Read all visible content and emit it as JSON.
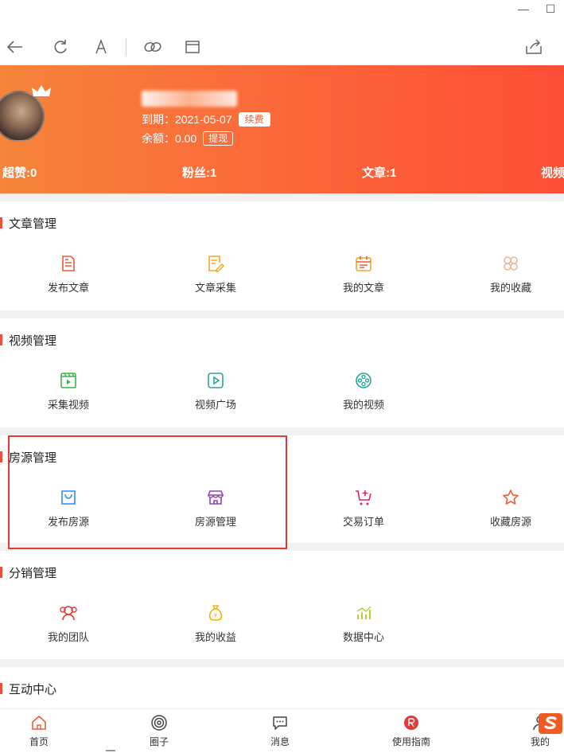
{
  "toolbar": {
    "icons": [
      "back-arrow-icon",
      "refresh-icon",
      "font-icon",
      "link-icon",
      "window-icon",
      "share-icon"
    ]
  },
  "profile": {
    "expiry_label": "到期：2021-05-07",
    "renew_label": "续费",
    "balance_label": "余额：0.00",
    "withdraw_label": "提现",
    "stats": [
      {
        "label": "超赞:0"
      },
      {
        "label": "粉丝:1"
      },
      {
        "label": "文章:1"
      },
      {
        "label": "视频"
      }
    ]
  },
  "sections": [
    {
      "title": "文章管理",
      "items": [
        {
          "label": "发布文章",
          "icon": "edit-document-icon",
          "color": "#f25a35"
        },
        {
          "label": "文章采集",
          "icon": "collect-edit-icon",
          "color": "#f5a623"
        },
        {
          "label": "我的文章",
          "icon": "calendar-icon",
          "color": "#f5a623"
        },
        {
          "label": "我的收藏",
          "icon": "clover-icon",
          "color": "#e6b89c"
        }
      ]
    },
    {
      "title": "视频管理",
      "items": [
        {
          "label": "采集视频",
          "icon": "video-clip-icon",
          "color": "#3cb44b"
        },
        {
          "label": "视频广场",
          "icon": "play-icon",
          "color": "#26a69a"
        },
        {
          "label": "我的视频",
          "icon": "film-reel-icon",
          "color": "#26a69a"
        }
      ]
    },
    {
      "title": "房源管理",
      "items": [
        {
          "label": "发布房源",
          "icon": "bag-icon",
          "color": "#2a8cf5"
        },
        {
          "label": "房源管理",
          "icon": "store-icon",
          "color": "#8e44ad"
        },
        {
          "label": "交易订单",
          "icon": "cart-add-icon",
          "color": "#e91e63"
        },
        {
          "label": "收藏房源",
          "icon": "star-icon",
          "color": "#f25a35"
        }
      ]
    },
    {
      "title": "分销管理",
      "items": [
        {
          "label": "我的团队",
          "icon": "team-icon",
          "color": "#e53935"
        },
        {
          "label": "我的收益",
          "icon": "money-bag-icon",
          "color": "#f5b400"
        },
        {
          "label": "数据中心",
          "icon": "bar-chart-icon",
          "color": "#c0ca33"
        }
      ]
    },
    {
      "title": "互动中心",
      "items": []
    }
  ],
  "bottom_nav": [
    {
      "label": "首页",
      "icon": "home-icon"
    },
    {
      "label": "圈子",
      "icon": "circle-icon"
    },
    {
      "label": "消息",
      "icon": "message-icon"
    },
    {
      "label": "使用指南",
      "icon": "guide-icon"
    },
    {
      "label": "我的",
      "icon": "user-icon"
    }
  ]
}
